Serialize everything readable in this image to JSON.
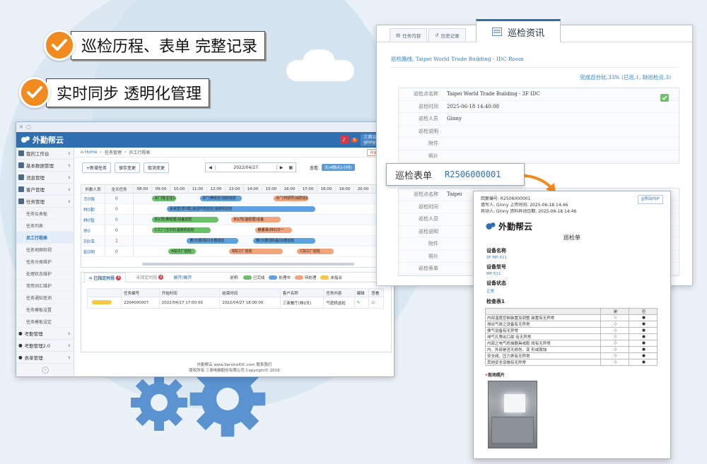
{
  "headlines": [
    {
      "text": "巡检历程、表单 完整记录"
    },
    {
      "text": "实时同步 透明化管理"
    }
  ],
  "app": {
    "brand": "外勤帮云",
    "user": {
      "company": "三商公司",
      "name": "ginny"
    },
    "notification_count": "5",
    "sidebar": {
      "items": [
        {
          "label": "我的工作台"
        },
        {
          "label": "基本数据管理"
        },
        {
          "label": "消息管理"
        },
        {
          "label": "客户管理"
        },
        {
          "label": "任务管理"
        }
      ],
      "subitems": [
        {
          "label": "任务仪表板"
        },
        {
          "label": "任务列表"
        },
        {
          "label": "员工行程表",
          "active": true
        },
        {
          "label": "任务地图检视"
        },
        {
          "label": "任务分类维护"
        },
        {
          "label": "处理状态维护"
        },
        {
          "label": "常用词汇维护"
        },
        {
          "label": "任务通知查询"
        },
        {
          "label": "任务模板设置"
        },
        {
          "label": "任务模板设定"
        }
      ],
      "bottom_items": [
        {
          "label": "考勤管理"
        },
        {
          "label": "考勤管理2.0"
        },
        {
          "label": "表单管理"
        }
      ]
    },
    "breadcrumb": {
      "home": "Home",
      "section": "任务管理",
      "page": "员工行程表",
      "option": "开启/关闭"
    },
    "toolbar": {
      "new_task": "+新增任务",
      "save": "保存变更",
      "cancel": "取消变更",
      "date": "2022/04/27",
      "view_label": "查看:",
      "view_value": "天(4隔点1小时)"
    },
    "gantt": {
      "head_name": "外勤人员",
      "head_total": "全天任务",
      "hours": [
        "08:00",
        "09:00",
        "10:00",
        "11:00",
        "12:00",
        "13:00",
        "14:00",
        "15:00",
        "16:00",
        "17:00",
        "18:00",
        "19:00",
        "20:00",
        "21:00"
      ],
      "rows": [
        {
          "name": "王0强",
          "total": "0",
          "bars": [
            {
              "label": "A厂(陈主任)冷一",
              "color": "green",
              "start": 9.0,
              "end": 10.3
            },
            {
              "label": "A厂(黄组长)消防巡检",
              "color": "blue",
              "start": 11.6,
              "end": 13.9
            },
            {
              "label": "A厂(何领导)消防巡检",
              "color": "orange",
              "start": 15.6,
              "end": 17.5
            }
          ]
        },
        {
          "name": "林0勤",
          "total": "0",
          "bars": [
            {
              "label": "喜来登(郭0霞)温湿环境监控/温度机巡检",
              "color": "blue",
              "start": 9.8,
              "end": 17.9
            }
          ]
        },
        {
          "name": "林0智",
          "total": "0",
          "bars": [
            {
              "label": "B公司(黄经理)设备巡检",
              "color": "green",
              "start": 9.0,
              "end": 12.6
            },
            {
              "label": "B公司(温经理)设备",
              "color": "orange",
              "start": 13.3,
              "end": 16.0
            }
          ]
        },
        {
          "name": "徐0",
          "total": "0",
          "bars": [
            {
              "label": "C工厂(王0华)温度机巡检",
              "color": "green",
              "start": 9.0,
              "end": 12.2
            },
            {
              "label": "赖董事(林0)冷一",
              "color": "orange",
              "start": 14.6,
              "end": 16.6
            }
          ]
        },
        {
          "name": "刘0浩",
          "total": "1",
          "bars": [
            {
              "label": "黄(大楼(陈0)大楼巡检",
              "color": "blue",
              "start": 10.9,
              "end": 13.7
            },
            {
              "label": "黄(大楼(郭0晶)大楼巡检",
              "color": "blue",
              "start": 14.5,
              "end": 17.9
            }
          ]
        },
        {
          "name": "彭0明",
          "total": "0",
          "bars": [
            {
              "label": "A加工厂巡检",
              "color": "green",
              "start": 9.9,
              "end": 11.4
            },
            {
              "label": "B加工厂巡检",
              "color": "orange",
              "start": 13.2,
              "end": 16.1
            },
            {
              "label": "C加工厂巡检",
              "color": "orange",
              "start": 16.9,
              "end": 18.9
            }
          ]
        }
      ]
    },
    "bottom_panel": {
      "tab_assigned": "已指定时段",
      "tab_assigned_count": "1",
      "tab_unassigned": "未指定时段",
      "tab_unassigned_count": "0",
      "expand": "展开/展开",
      "legend_label": "说明:",
      "legend": [
        {
          "label": "已完成",
          "color": "#6cc06a"
        },
        {
          "label": "处理中",
          "color": "#5ea1e0"
        },
        {
          "label": "待处理",
          "color": "#f2a47c"
        },
        {
          "label": "未指派",
          "color": "#f5c842"
        }
      ],
      "columns": [
        "任务编号",
        "开始时间",
        "结束时间",
        "客户名称",
        "任务内容",
        "编辑",
        "查看"
      ],
      "rows": [
        {
          "id": "2204000007",
          "start": "2022/04/27 17:00:00",
          "end": "2022/04/27 18:00:00",
          "client": "三商餐厅(林0文)",
          "content": "气密机巡检"
        }
      ]
    },
    "footer": {
      "line1": "外勤帮云 www.ServiceIDC.com 联系我们",
      "line2": "版权所有 三商电脑股份有限公司 Copyright© 2016"
    }
  },
  "info_panel": {
    "tabs": [
      "任务内容",
      "历史记录"
    ],
    "main_tab": "巡检资讯",
    "route": "巡检路线, Taipei World Trade Building - IDC Room",
    "completion": "完成百分比,33% (已巡,1, 缺巡检点,3)",
    "record": {
      "labels": [
        "巡检点名称",
        "巡检时间",
        "巡检人员",
        "巡检说明",
        "附件",
        "照片"
      ],
      "values": [
        "Taipei World Trade Building - 3F IDC",
        "2025-06-18 14:40:08",
        "Ginny",
        "",
        "",
        ""
      ]
    },
    "record2": {
      "labels": [
        "巡检点名称",
        "巡检时间",
        "巡检人员",
        "巡检说明",
        "附件",
        "照片",
        "巡检表单"
      ],
      "values": [
        "Taipei",
        "",
        "",
        "",
        "",
        "",
        ""
      ]
    }
  },
  "callout": {
    "label": "巡检表单",
    "number": "R2506000001"
  },
  "form_doc": {
    "pdf_button": "导出PDF",
    "line1": "回复编号: R2506000001",
    "line2": "填写人: Ginny  上传时间: 2025-06-18 14:46",
    "line3": "异动人: Ginny  资料异动日期: 2025-06-18 14:46",
    "brand": "外勤帮云",
    "title": "巡检单",
    "device_name_label": "设备名称",
    "device_name": "3F MP-511",
    "device_model_label": "设备型号",
    "device_model": "MP-511",
    "device_status_label": "设备状态",
    "device_status": "正常",
    "checklist_label": "检查表1",
    "checklist_cols": [
      "",
      "是",
      "否"
    ],
    "checklist": [
      "内部温度控制装置及调整 装置有无异常",
      "排出气体之设备有无异常",
      "换气设备有无异常",
      "排气孔等出口部 有无异常",
      "内部之电气机械器具或配 线有无异常",
      "内、外部是否无损伤、变 形或腐蚀",
      "安全阀、压力表有无异常",
      "其他安全设施有无异常"
    ],
    "photo_label": "现场照片"
  }
}
